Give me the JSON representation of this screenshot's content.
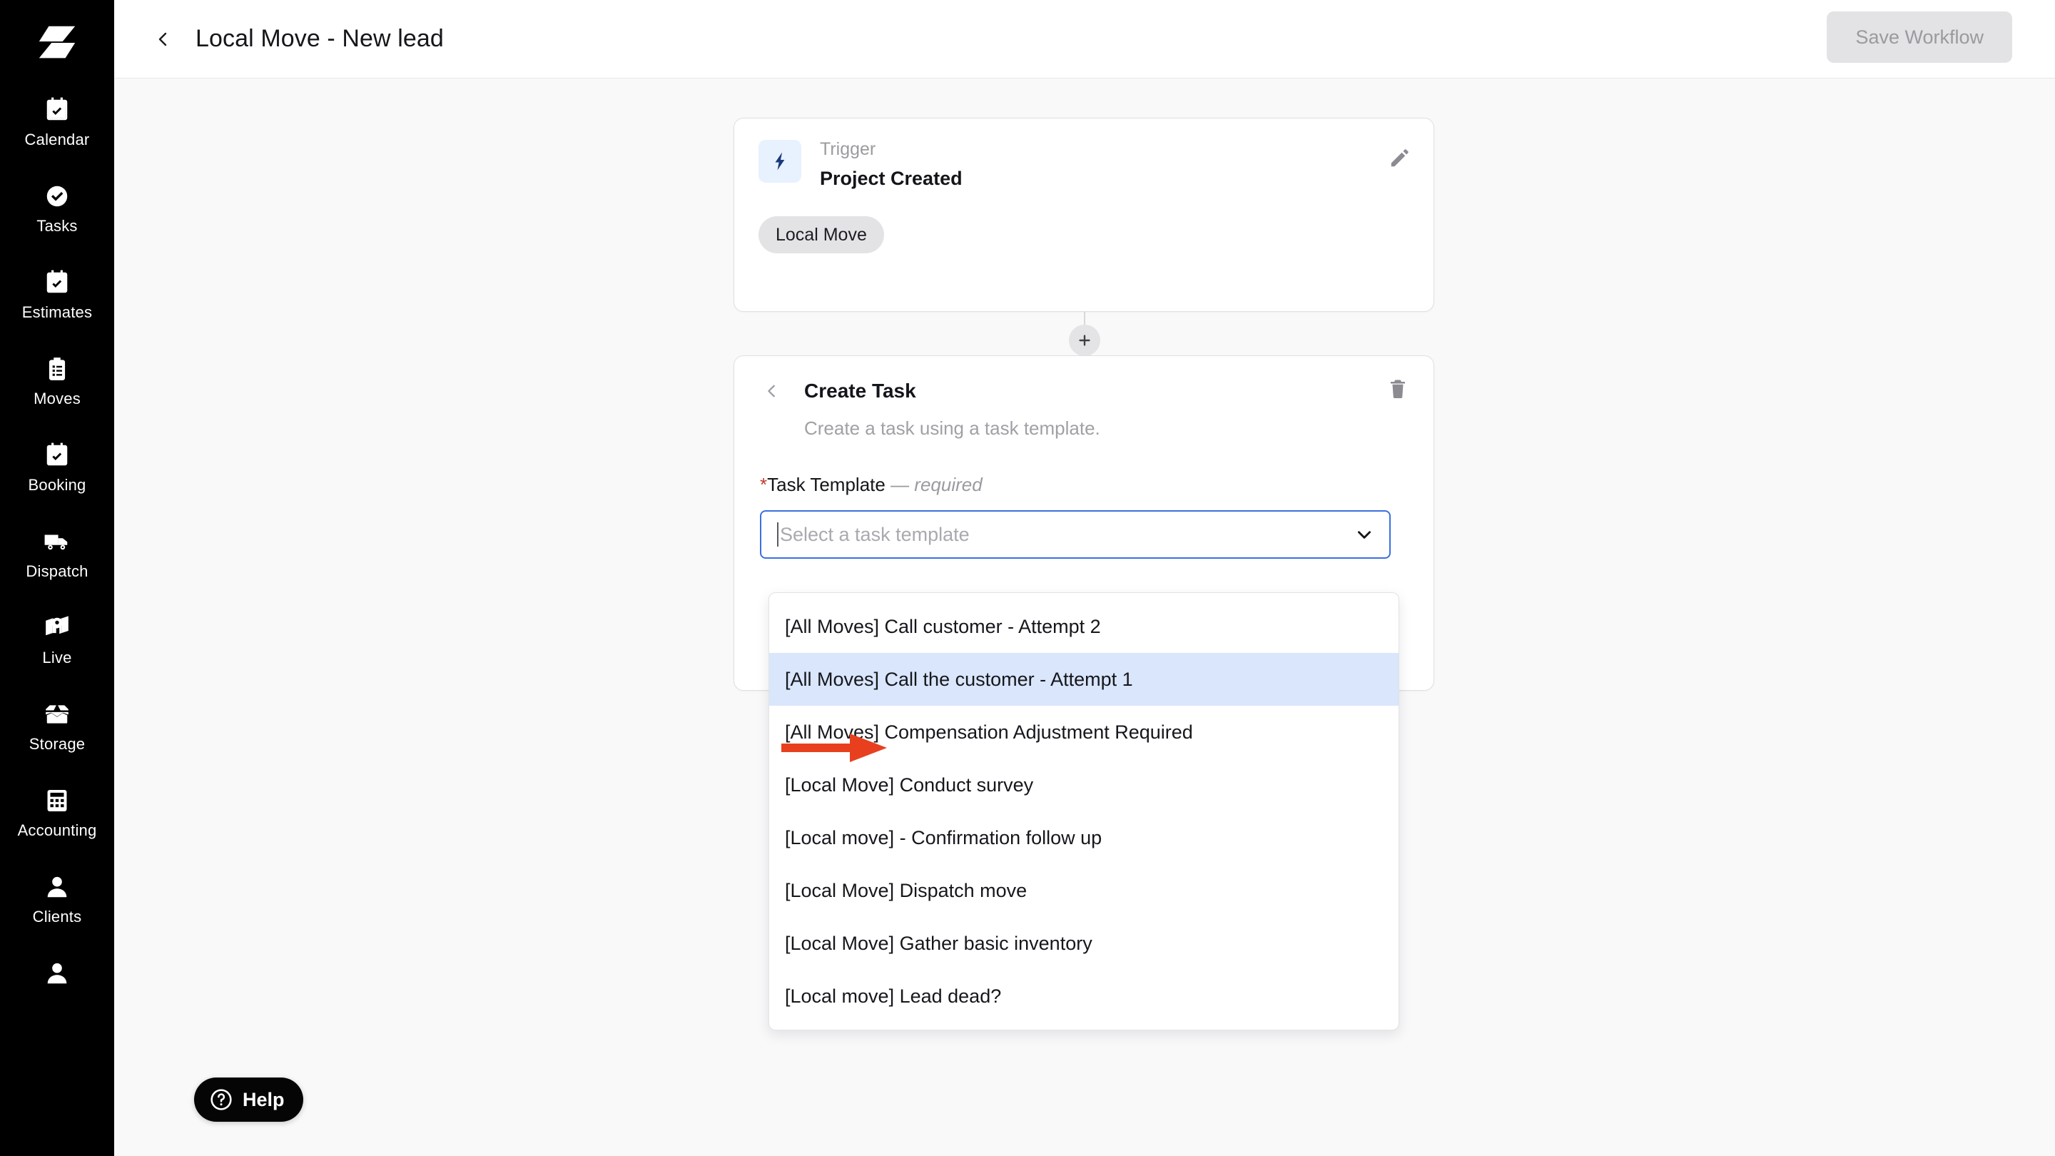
{
  "app": {
    "logo_icon": "smartmoving-bolt-logo"
  },
  "sidebar": {
    "items": [
      {
        "label": "Calendar",
        "icon": "calendar-check-icon"
      },
      {
        "label": "Tasks",
        "icon": "check-circle-icon"
      },
      {
        "label": "Estimates",
        "icon": "calendar-check-icon"
      },
      {
        "label": "Moves",
        "icon": "clipboard-list-icon"
      },
      {
        "label": "Booking",
        "icon": "calendar-check-icon"
      },
      {
        "label": "Dispatch",
        "icon": "truck-icon"
      },
      {
        "label": "Live",
        "icon": "map-pin-icon"
      },
      {
        "label": "Storage",
        "icon": "open-box-icon"
      },
      {
        "label": "Accounting",
        "icon": "calculator-icon"
      },
      {
        "label": "Clients",
        "icon": "person-icon"
      },
      {
        "label": "",
        "icon": "person-icon"
      }
    ]
  },
  "header": {
    "back_icon": "chevron-left-icon",
    "title": "Local Move - New lead",
    "save_label": "Save Workflow"
  },
  "trigger_card": {
    "icon": "lightning-bolt-icon",
    "kicker": "Trigger",
    "name": "Project Created",
    "chip": "Local Move",
    "edit_icon": "pencil-icon"
  },
  "connector": {
    "add_icon": "plus-icon"
  },
  "task_card": {
    "back_icon": "chevron-left-icon",
    "title": "Create Task",
    "delete_icon": "trash-icon",
    "subtitle": "Create a task using a task template.",
    "field": {
      "required_star": "*",
      "label": "Task Template",
      "required_note": "— required",
      "placeholder": "Select a task template",
      "value": "",
      "chevron_icon": "chevron-down-icon"
    }
  },
  "dropdown": {
    "highlighted_index": 1,
    "options": [
      "[All Moves] Call customer - Attempt 2",
      "[All Moves] Call the customer - Attempt 1",
      "[All Moves] Compensation Adjustment Required",
      "[Local Move] Conduct survey",
      "[Local move] - Confirmation follow up",
      "[Local Move] Dispatch move",
      "[Local Move] Gather basic inventory",
      "[Local move] Lead dead?"
    ]
  },
  "annotation": {
    "arrow_color": "#e8401f",
    "points_to": "[All Moves] Call the customer - Attempt 1"
  },
  "help": {
    "icon": "question-circle-icon",
    "label": "Help"
  },
  "colors": {
    "sidebar_bg": "#000000",
    "canvas_bg": "#f9f9fa",
    "accent_focus": "#3b6fe0",
    "highlight_row": "#d9e6fb",
    "trigger_badge_bg": "#e8f1fe",
    "chip_bg": "#e3e3e5",
    "required_star": "#c0392b"
  }
}
